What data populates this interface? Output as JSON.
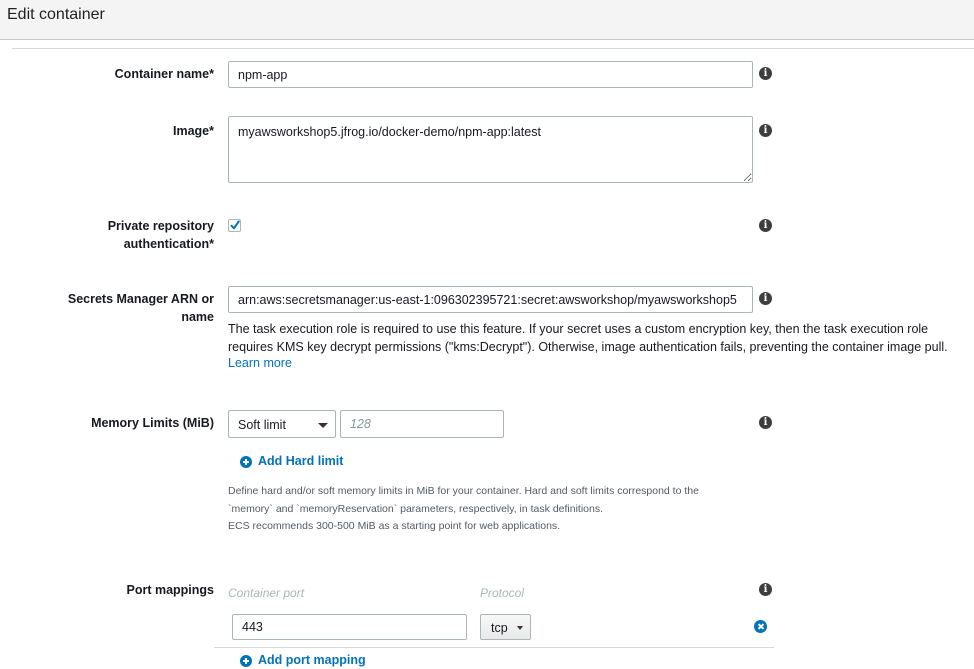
{
  "header": {
    "title": "Edit container"
  },
  "container_name": {
    "label": "Container name*",
    "value": "npm-app"
  },
  "image": {
    "label": "Image*",
    "value": "myawsworkshop5.jfrog.io/docker-demo/npm-app:latest"
  },
  "private_auth": {
    "label_line1": "Private repository",
    "label_line2": "authentication*",
    "checked": true
  },
  "secrets": {
    "label_line1": "Secrets Manager ARN or",
    "label_line2": "name",
    "value": "arn:aws:secretsmanager:us-east-1:096302395721:secret:awsworkshop/myawsworkshop5",
    "help_text": "The task execution role is required to use this feature. If your secret uses a custom encryption key, then the task execution role requires KMS key decrypt permissions (\"kms:Decrypt\"). Otherwise, image authentication fails, preventing the container image pull.",
    "learn_more": "Learn more"
  },
  "memory": {
    "label": "Memory Limits (MiB)",
    "limit_type": "Soft limit",
    "placeholder": "128",
    "add_hard_limit": "Add Hard limit",
    "help_line1": "Define hard and/or soft memory limits in MiB for your container. Hard and soft limits correspond to the",
    "help_line2": "`memory` and `memoryReservation` parameters, respectively, in task definitions.",
    "help_line3": "ECS recommends 300-500 MiB as a starting point for web applications."
  },
  "ports": {
    "label": "Port mappings",
    "col_container_port": "Container port",
    "col_protocol": "Protocol",
    "container_port": "443",
    "protocol": "tcp",
    "add_port_mapping": "Add port mapping"
  },
  "icons": {
    "info": "info-icon",
    "check": "checkmark-icon",
    "add": "plus-circle-icon",
    "remove": "remove-circle-icon",
    "caret": "caret-down-icon"
  },
  "colors": {
    "link": "#0073bb",
    "header_bg": "#f4f4f4",
    "icon_dark": "#3e3e3e"
  }
}
